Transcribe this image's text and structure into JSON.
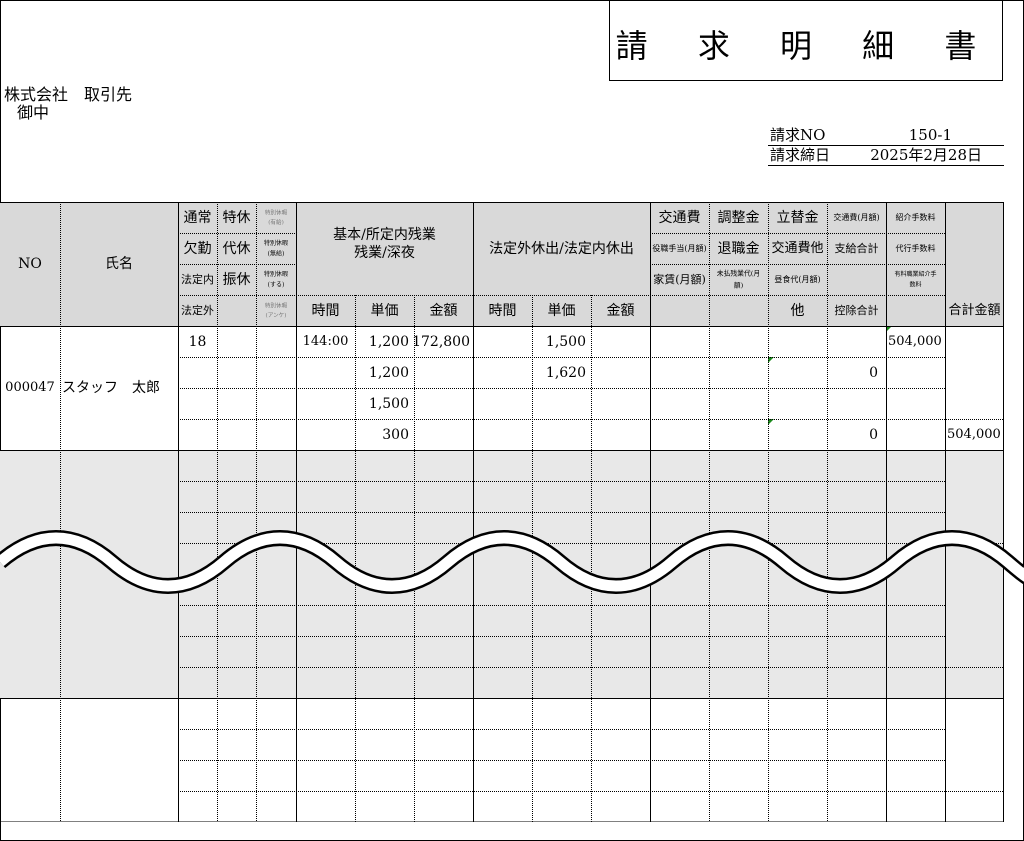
{
  "title": "請 求 明 細 書",
  "client": {
    "company": "株式会社　取引先",
    "honorific": "御中"
  },
  "invoice": {
    "no_label": "請求NO",
    "no_value": "150-1",
    "date_label": "請求締日",
    "date_value": "2025年2月28日"
  },
  "header": {
    "no": "NO",
    "name": "氏名",
    "col1": [
      "通常",
      "欠勤",
      "法定内",
      "法定外"
    ],
    "col2": [
      "特休",
      "代休",
      "振休"
    ],
    "col3": [
      "特別休暇(有給)",
      "特別休暇(無給)",
      "特別休暇(する)",
      "特別休暇(アンケ)"
    ],
    "basic": "基本/所定内残業",
    "basic2": "残業/深夜",
    "holiday": "法定外休出/法定内休出",
    "time": "時間",
    "unit": "単価",
    "amount": "金額",
    "colA": [
      "交通費",
      "役職手当(月額)",
      "家賃(月額)"
    ],
    "colB": [
      "調整金",
      "退職金",
      "未払残業代(月額)"
    ],
    "colC": [
      "立替金",
      "交通費他",
      "昼食代(月額)",
      "他"
    ],
    "colD": [
      "交通費(月額)",
      "支給合計",
      "控除合計"
    ],
    "colE": [
      "紹介手数料",
      "代行手数料",
      "有料職業紹介手数料"
    ],
    "total": "合計金額"
  },
  "rows": [
    {
      "no": "000047",
      "name": "スタッフ　太郎",
      "col1_top": "18",
      "basic": {
        "time": "144:00",
        "units": [
          "1,200",
          "1,200",
          "1,500",
          "300"
        ],
        "amount": "172,800"
      },
      "holiday": {
        "units": [
          "1,500",
          "1,620"
        ]
      },
      "deduction_values": [
        "0",
        "0"
      ],
      "fee": "504,000",
      "total": "504,000"
    }
  ]
}
